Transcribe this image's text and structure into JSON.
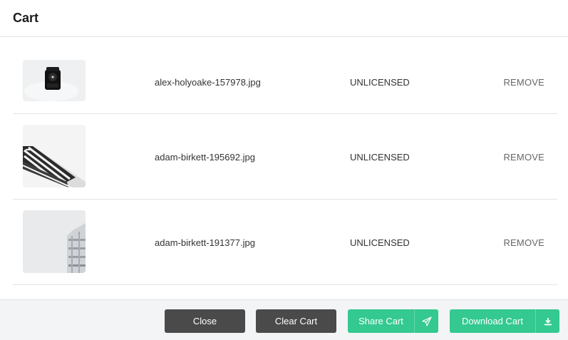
{
  "title": "Cart",
  "items": [
    {
      "filename": "alex-holyoake-157978.jpg",
      "license": "UNLICENSED",
      "remove_label": "REMOVE",
      "thumb_icon": "camera-photo-thumbnail"
    },
    {
      "filename": "adam-birkett-195692.jpg",
      "license": "UNLICENSED",
      "remove_label": "REMOVE",
      "thumb_icon": "awning-photo-thumbnail"
    },
    {
      "filename": "adam-birkett-191377.jpg",
      "license": "UNLICENSED",
      "remove_label": "REMOVE",
      "thumb_icon": "building-photo-thumbnail"
    }
  ],
  "footer": {
    "close_label": "Close",
    "clear_label": "Clear Cart",
    "share_label": "Share Cart",
    "share_icon": "paper-plane-icon",
    "download_label": "Download Cart",
    "download_icon": "download-icon"
  },
  "colors": {
    "dark_button": "#4a4a4a",
    "green_button": "#33c990",
    "footer_bg": "#f3f4f6"
  }
}
